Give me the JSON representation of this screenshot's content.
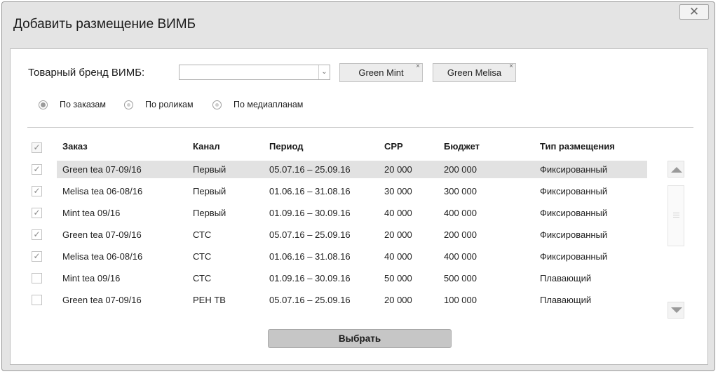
{
  "dialog": {
    "title": "Добавить размещение ВИМБ",
    "close_label": "✕"
  },
  "brand": {
    "label": "Товарный бренд ВИМБ:",
    "select_value": "",
    "tags": [
      {
        "label": "Green Mint",
        "remove": "×"
      },
      {
        "label": "Green Melisa",
        "remove": "×"
      }
    ]
  },
  "modes": [
    {
      "label": "По заказам",
      "selected": true
    },
    {
      "label": "По роликам",
      "selected": false
    },
    {
      "label": "По медиапланам",
      "selected": false
    }
  ],
  "table": {
    "headers": {
      "order": "Заказ",
      "channel": "Канал",
      "period": "Период",
      "cpp": "CPP",
      "budget": "Бюджет",
      "type": "Тип размещения"
    },
    "rows": [
      {
        "order": "Green tea 07-09/16",
        "channel": "Первый",
        "period": "05.07.16 – 25.09.16",
        "cpp": "20 000",
        "budget": "200 000",
        "type": "Фиксированный",
        "checked": true,
        "highlighted": true
      },
      {
        "order": "Melisa tea 06-08/16",
        "channel": "Первый",
        "period": "01.06.16 – 31.08.16",
        "cpp": "30 000",
        "budget": "300 000",
        "type": "Фиксированный",
        "checked": true,
        "highlighted": false
      },
      {
        "order": "Mint tea 09/16",
        "channel": "Первый",
        "period": "01.09.16 – 30.09.16",
        "cpp": "40 000",
        "budget": "400 000",
        "type": "Фиксированный",
        "checked": true,
        "highlighted": false
      },
      {
        "order": "Green tea 07-09/16",
        "channel": "СТС",
        "period": "05.07.16 – 25.09.16",
        "cpp": "20 000",
        "budget": "200 000",
        "type": "Фиксированный",
        "checked": true,
        "highlighted": false
      },
      {
        "order": "Melisa tea 06-08/16",
        "channel": "СТС",
        "period": "01.06.16 – 31.08.16",
        "cpp": "40 000",
        "budget": "400 000",
        "type": "Фиксированный",
        "checked": true,
        "highlighted": false
      },
      {
        "order": "Mint tea 09/16",
        "channel": "СТС",
        "period": "01.09.16 – 30.09.16",
        "cpp": "50 000",
        "budget": "500 000",
        "type": "Плавающий",
        "checked": false,
        "highlighted": false
      },
      {
        "order": "Green tea 07-09/16",
        "channel": "РЕН ТВ",
        "period": "05.07.16 – 25.09.16",
        "cpp": "20 000",
        "budget": "100 000",
        "type": "Плавающий",
        "checked": false,
        "highlighted": false
      }
    ]
  },
  "actions": {
    "choose_label": "Выбрать"
  },
  "colors": {
    "window_bg": "#e4e4e4",
    "row_highlight": "#e2e2e2",
    "button_bg": "#c6c6c6"
  }
}
